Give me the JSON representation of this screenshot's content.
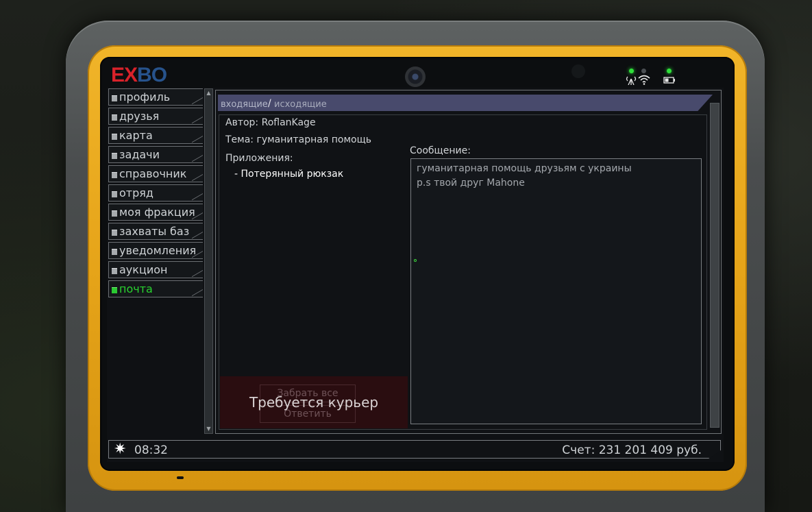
{
  "brand": {
    "logo_part1": "EX",
    "logo_part2": "BO"
  },
  "sidebar": {
    "items": [
      {
        "label": "профиль"
      },
      {
        "label": "друзья"
      },
      {
        "label": "карта"
      },
      {
        "label": "задачи"
      },
      {
        "label": "справочник"
      },
      {
        "label": "отряд"
      },
      {
        "label": "моя фракция"
      },
      {
        "label": "захваты баз"
      },
      {
        "label": "уведомления"
      },
      {
        "label": "аукцион"
      },
      {
        "label": "почта",
        "active": true
      }
    ]
  },
  "tabs": {
    "incoming": "входящие",
    "separator": "/",
    "outgoing": "исходящие"
  },
  "mail": {
    "author_line": "Автор: RoflanKage",
    "subject_line": "Тема: гуманитарная помощь",
    "attachments_label": "Приложения:",
    "attachment_item": "- Потерянный рюкзак",
    "message_label": "Сообщение:",
    "message_line1": "гуманитарная помощь друзьям с украины",
    "message_line2": "p.s твой друг Mahone"
  },
  "actions": {
    "take_all": "Забрать все",
    "reply": "Ответить",
    "courier_required": "Требуется курьер"
  },
  "status": {
    "time": "08:32",
    "balance": "Счет: 231 201 409 руб."
  },
  "colors": {
    "accent_green": "#29d32f",
    "tab_bar": "#484a6c",
    "orange_frame": "#e6a419"
  }
}
